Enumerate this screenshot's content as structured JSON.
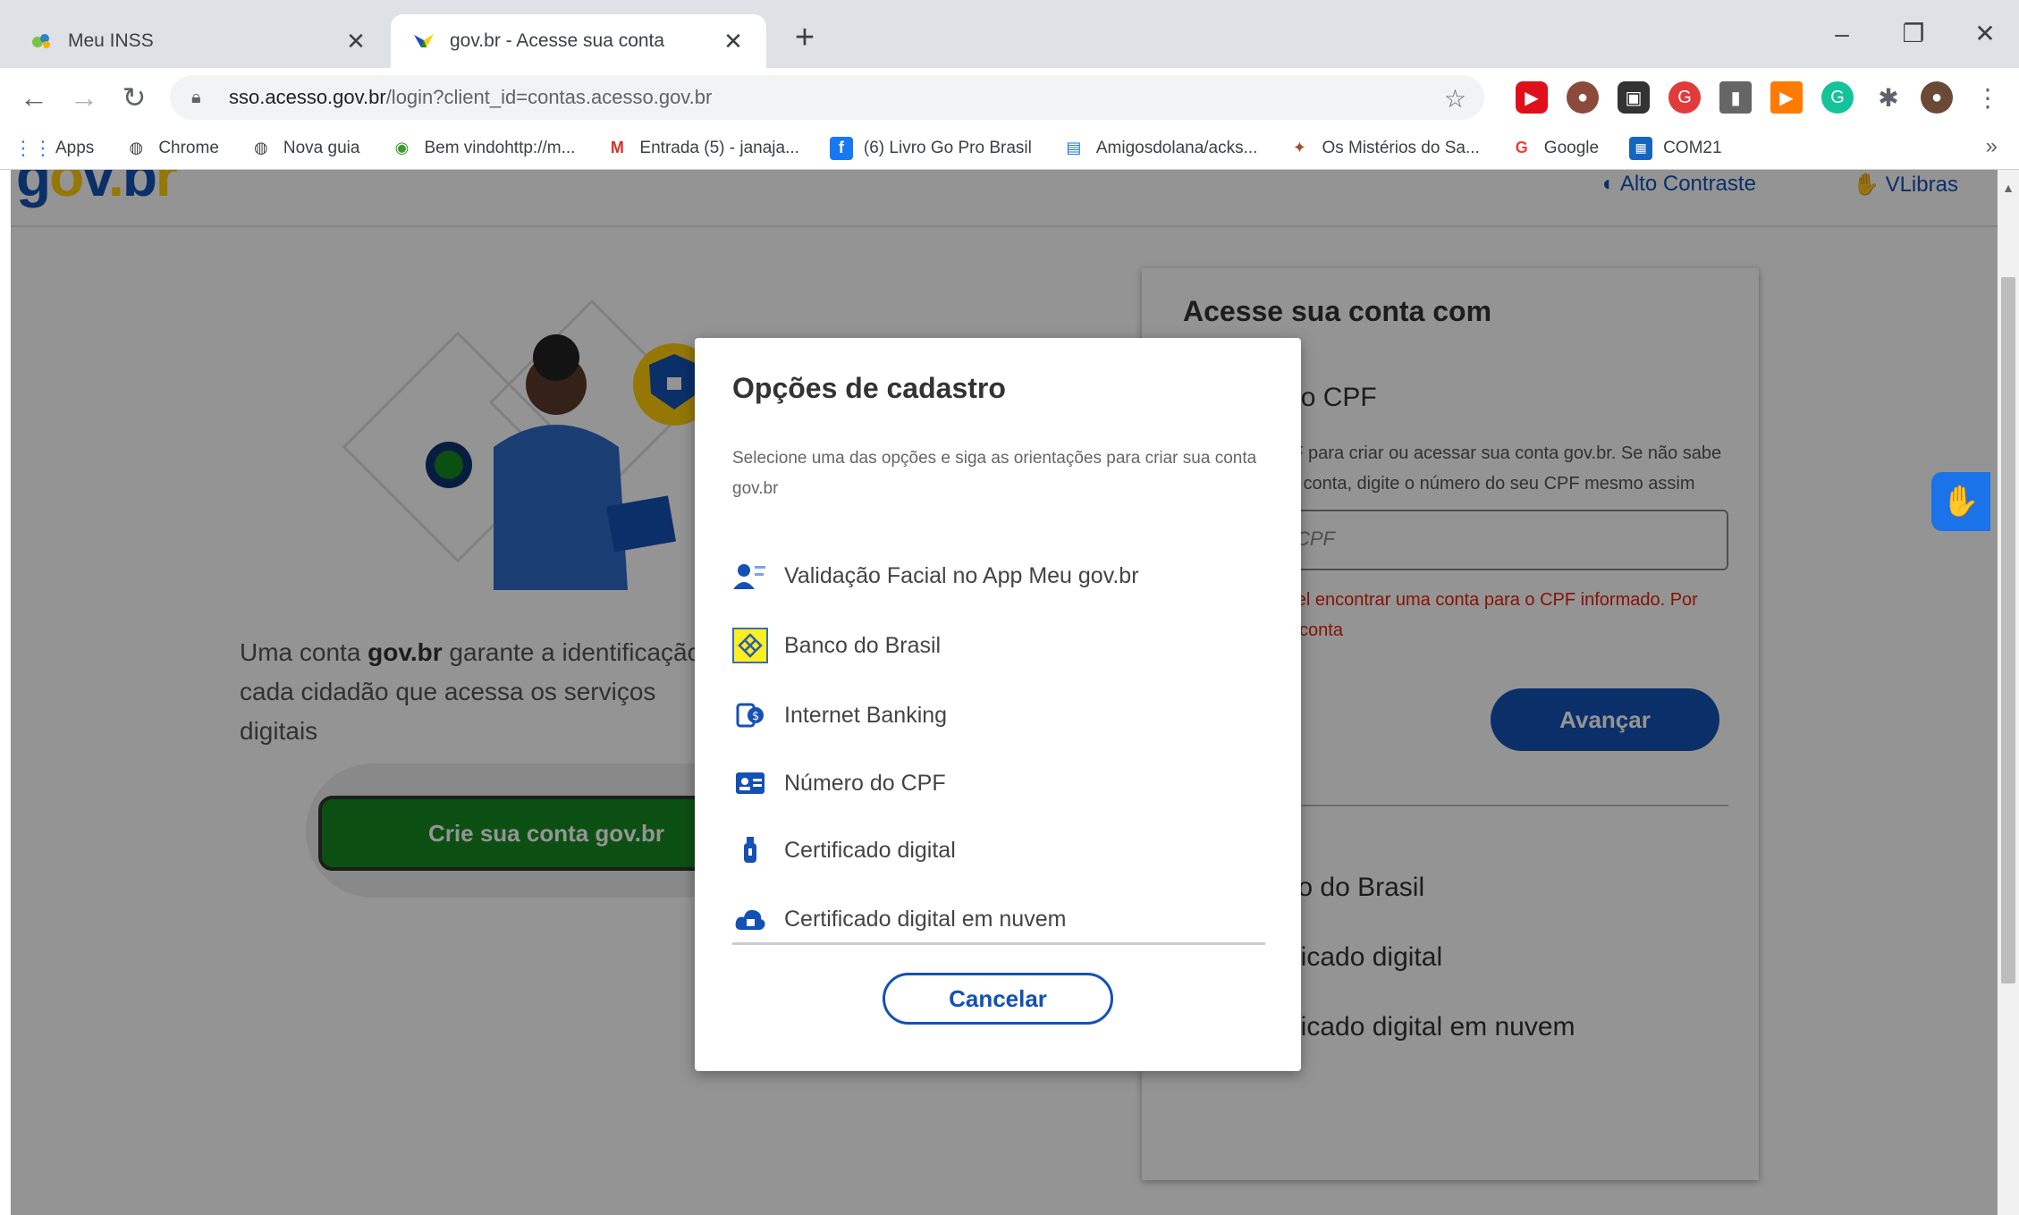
{
  "browser": {
    "tabs": [
      {
        "title": "Meu INSS",
        "icon": "inss-favicon"
      },
      {
        "title": "gov.br - Acesse sua conta",
        "icon": "govbr-favicon"
      }
    ],
    "url": {
      "host": "sso.acesso.gov.br",
      "path": "/login?client_id=contas.acesso.gov.br"
    },
    "bookmarks": [
      {
        "label": "Apps",
        "icon": "apps-grid-icon"
      },
      {
        "label": "Chrome",
        "icon": "globe-icon"
      },
      {
        "label": "Nova guia",
        "icon": "globe-icon"
      },
      {
        "label": "Bem vindohttp://m...",
        "icon": "globe-green-icon"
      },
      {
        "label": "Entrada (5) - janaja...",
        "icon": "gmail-icon"
      },
      {
        "label": "(6) Livro Go Pro Brasil",
        "icon": "facebook-icon"
      },
      {
        "label": "Amigosdolana/acks...",
        "icon": "page-icon"
      },
      {
        "label": "Os Mistérios do Sa...",
        "icon": "figure-icon"
      },
      {
        "label": "Google",
        "icon": "google-icon"
      },
      {
        "label": "COM21",
        "icon": "square-icon"
      }
    ]
  },
  "site": {
    "logo": {
      "g": "g",
      "o": "o",
      "v": "v",
      "dot": ".",
      "b": "b",
      "r": "r"
    },
    "header_links": [
      "Alto Contraste",
      "VLibras"
    ],
    "hero": {
      "text_before": "Uma conta ",
      "text_bold": "gov.br",
      "text_after": " garante a identificação de cada cidadão que acessa os serviços digitais",
      "create_button": "Crie sua conta gov.br"
    },
    "login": {
      "title": "Acesse sua conta com",
      "cpf_title": "Número do CPF",
      "cpf_desc": "Digite seu CPF para criar ou acessar sua conta gov.br. Se não sabe se possui uma conta, digite o número do seu CPF mesmo assim para verificar",
      "cpf_placeholder": "Digite seu CPF",
      "error": "Não foi possível encontrar uma conta para o CPF informado. Por favor, crie sua conta",
      "next_button": "Avançar",
      "other_options": [
        {
          "label": "Banco do Brasil",
          "icon": "bank-icon"
        },
        {
          "label": "Certificado digital",
          "icon": "usb-token-icon"
        },
        {
          "label": "Certificado digital em nuvem",
          "icon": "cloud-lock-icon"
        }
      ]
    }
  },
  "modal": {
    "title": "Opções de cadastro",
    "description": "Selecione uma das opções e siga as orientações para criar sua conta gov.br",
    "options": [
      {
        "label": "Validação Facial no App Meu gov.br",
        "icon": "face-id-icon"
      },
      {
        "label": "Banco do Brasil",
        "icon": "banco-do-brasil-icon"
      },
      {
        "label": "Internet Banking",
        "icon": "internet-banking-icon"
      },
      {
        "label": "Número do CPF",
        "icon": "id-card-icon"
      },
      {
        "label": "Certificado digital",
        "icon": "usb-token-icon"
      },
      {
        "label": "Certificado digital em nuvem",
        "icon": "cloud-lock-icon"
      }
    ],
    "cancel_button": "Cancelar"
  },
  "colors": {
    "brand_blue": "#1351b4",
    "brand_green": "#168821",
    "error_red": "#e52207",
    "logo_yellow": "#ffcd07"
  }
}
